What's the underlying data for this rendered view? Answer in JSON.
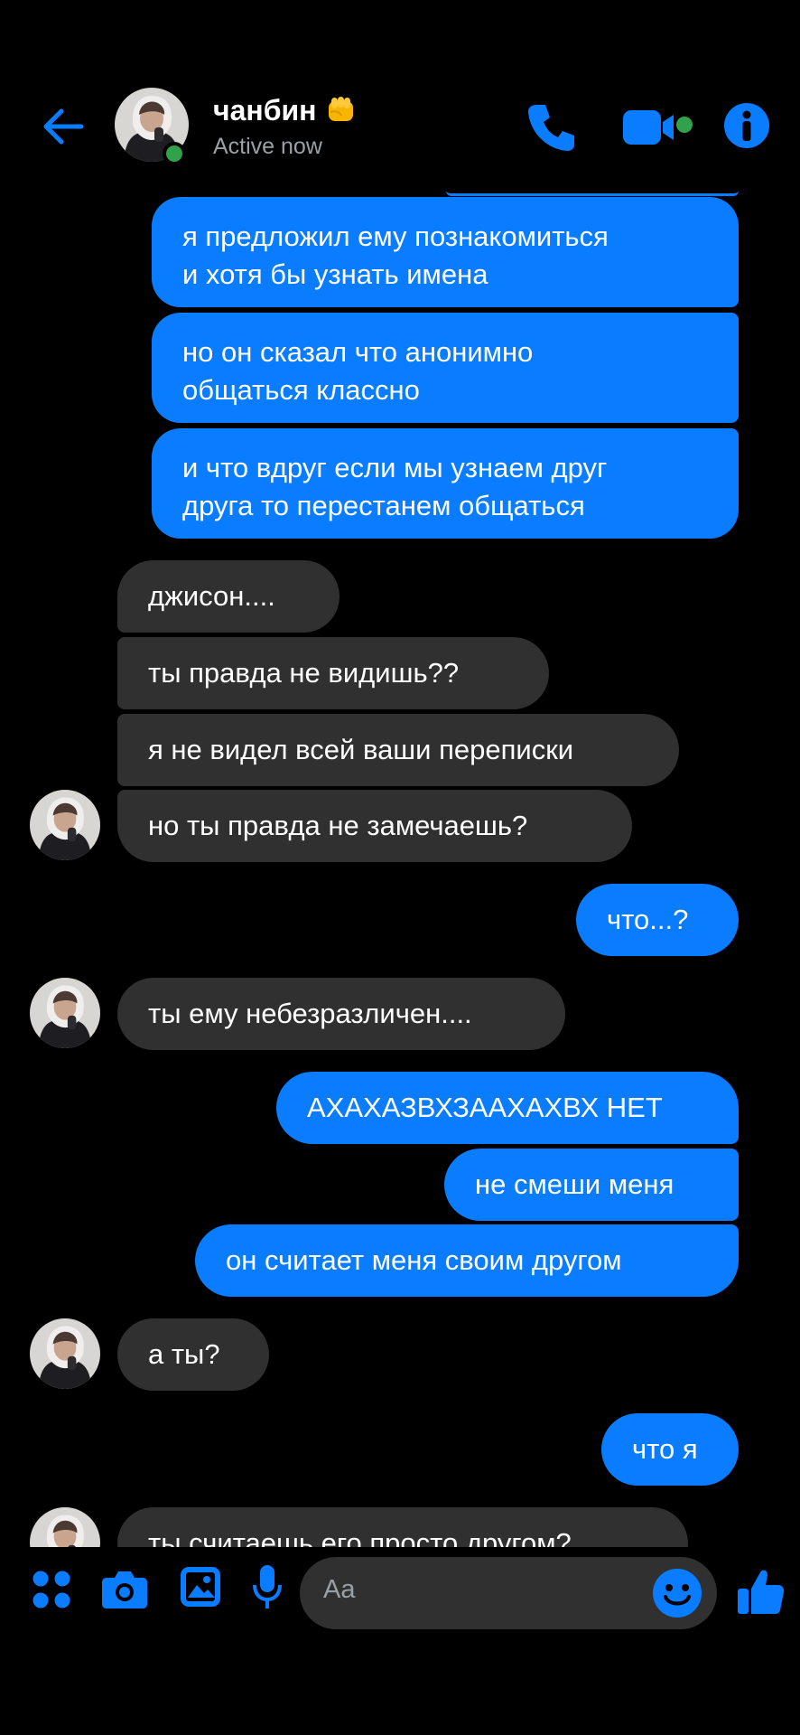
{
  "header": {
    "contact_name": "чанбин",
    "status": "Active now",
    "accent": "#0a7cff",
    "online_color": "#31a24c",
    "name_emoji": "fist-emoji"
  },
  "messages": [
    {
      "side": "out",
      "text": "я предложил ему познакомиться\nи хотя бы узнать имена"
    },
    {
      "side": "out",
      "text": "но он сказал что анонимно\nобщаться классно"
    },
    {
      "side": "out",
      "text": "и что вдруг если мы узнаем друг\nдруга то перестанем общаться"
    },
    {
      "side": "in",
      "text": "джисон...."
    },
    {
      "side": "in",
      "text": "ты правда не видишь??"
    },
    {
      "side": "in",
      "text": "я не видел всей ваши переписки"
    },
    {
      "side": "in",
      "text": "но ты правда не замечаешь?"
    },
    {
      "side": "out",
      "text": "что...?"
    },
    {
      "side": "in",
      "text": "ты ему небезразличен...."
    },
    {
      "side": "out",
      "text": "АХАХАЗВХЗААХАХВХ НЕТ"
    },
    {
      "side": "out",
      "text": "не смеши меня"
    },
    {
      "side": "out",
      "text": "он считает меня своим другом"
    },
    {
      "side": "in",
      "text": "а ты?"
    },
    {
      "side": "out",
      "text": "что я"
    },
    {
      "side": "in",
      "text": "ты считаешь его просто другом?"
    }
  ],
  "composer": {
    "placeholder": "Aa",
    "icons": [
      "menu-icon",
      "camera-icon",
      "gallery-icon",
      "microphone-icon",
      "emoji-icon",
      "like-icon"
    ]
  }
}
